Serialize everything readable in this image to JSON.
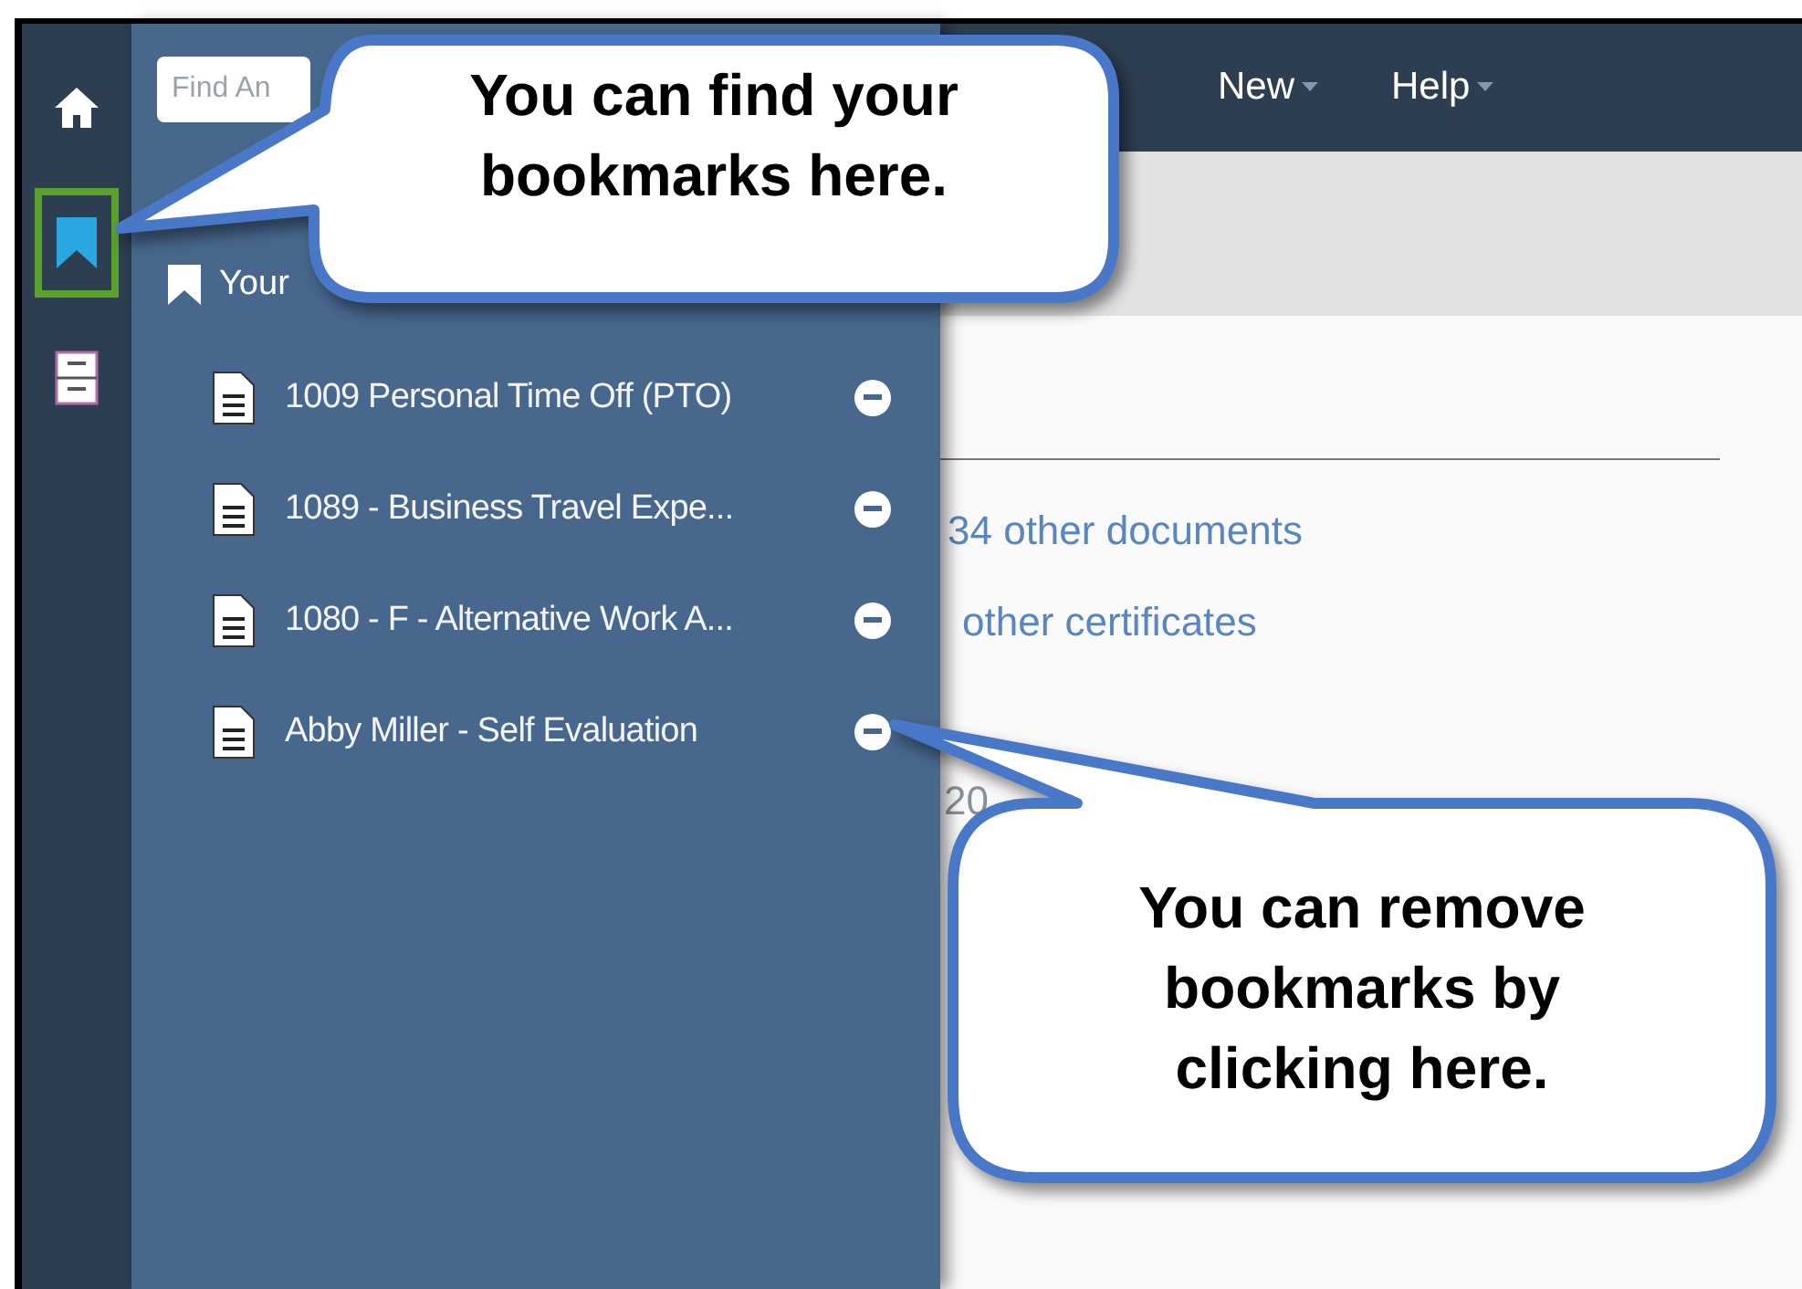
{
  "search": {
    "placeholder": "Find An"
  },
  "nav": [
    {
      "label": "New"
    },
    {
      "label": "Help"
    }
  ],
  "rail": [
    {
      "kind": "home",
      "selected": false
    },
    {
      "kind": "bookmark",
      "selected": true
    },
    {
      "kind": "cabinet",
      "selected": false
    }
  ],
  "bookmarks": {
    "heading": "Your",
    "items": [
      {
        "title": "1009 Personal Time Off (PTO)"
      },
      {
        "title": "1089 - Business Travel Expe..."
      },
      {
        "title": "1080 - F - Alternative Work A..."
      },
      {
        "title": "Abby Miller - Self Evaluation"
      }
    ]
  },
  "content": {
    "links": [
      "34 other documents",
      "other certificates"
    ],
    "partial_text": "20"
  },
  "callouts": [
    {
      "lines": [
        "You can find your",
        "bookmarks here."
      ]
    },
    {
      "lines": [
        "You can remove",
        "bookmarks by",
        "clicking here."
      ]
    }
  ]
}
